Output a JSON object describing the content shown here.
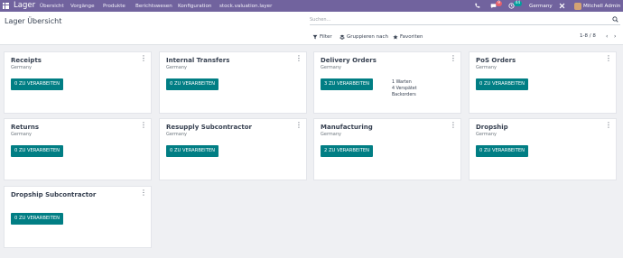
{
  "navbar": {
    "app_name": "Lager",
    "menu": [
      "Übersicht",
      "Vorgänge",
      "Produkte",
      "Berichtswesen",
      "Konfiguration",
      "stock.valuation.layer"
    ],
    "chat_badge": "9",
    "activity_badge": "44",
    "company": "Germany",
    "user": "Mitchell Admin",
    "colors": {
      "brand": "#71639e",
      "chat_badge": "#e4606d",
      "activity_badge": "#00a09d"
    }
  },
  "control": {
    "title": "Lager Übersicht",
    "search_placeholder": "Suchen...",
    "filter_label": "Filter",
    "group_label": "Gruppieren nach",
    "favorites_label": "Favoriten",
    "pager": "1-8 / 8"
  },
  "cards": [
    {
      "title": "Receipts",
      "company": "Germany",
      "button": "0 ZU VERARBEITEN",
      "links": []
    },
    {
      "title": "Internal Transfers",
      "company": "Germany",
      "button": "0 ZU VERARBEITEN",
      "links": []
    },
    {
      "title": "Delivery Orders",
      "company": "Germany",
      "button": "3 ZU VERARBEITEN",
      "links": [
        "1 Warten",
        "4 Verspätet",
        "Backorders"
      ]
    },
    {
      "title": "PoS Orders",
      "company": "Germany",
      "button": "0 ZU VERARBEITEN",
      "links": []
    },
    {
      "title": "Returns",
      "company": "Germany",
      "button": "0 ZU VERARBEITEN",
      "links": []
    },
    {
      "title": "Resupply Subcontractor",
      "company": "Germany",
      "button": "0 ZU VERARBEITEN",
      "links": []
    },
    {
      "title": "Manufacturing",
      "company": "Germany",
      "button": "2 ZU VERARBEITEN",
      "links": []
    },
    {
      "title": "Dropship",
      "company": "Germany",
      "button": "0 ZU VERARBEITEN",
      "links": []
    },
    {
      "title": "Dropship Subcontractor",
      "company": "",
      "button": "0 ZU VERARBEITEN",
      "links": []
    }
  ],
  "theme": {
    "button_color": "#017e84",
    "background": "#eff0f3"
  }
}
